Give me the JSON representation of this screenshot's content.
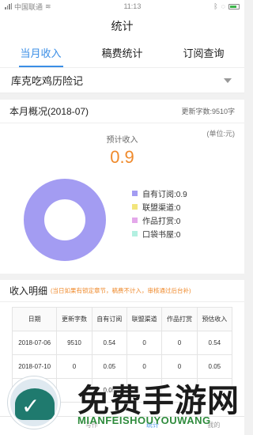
{
  "status_bar": {
    "carrier": "中国联通",
    "time": "11:13"
  },
  "nav": {
    "title": "统计"
  },
  "tabs": [
    {
      "label": "当月收入",
      "active": true
    },
    {
      "label": "稿费统计",
      "active": false
    },
    {
      "label": "订阅查询",
      "active": false
    }
  ],
  "book_select": {
    "value": "库克吃鸡历险记"
  },
  "overview": {
    "title": "本月概况(2018-07)",
    "words": "更新字数:9510字",
    "unit": "(单位:元)",
    "estimate_label": "预计收入",
    "estimate_value": "0.9"
  },
  "chart_data": {
    "type": "pie",
    "categories": [
      "自有订阅",
      "联盟渠道",
      "作品打赏",
      "口袋书屋"
    ],
    "values": [
      0.9,
      0,
      0,
      0
    ],
    "legend_labels": [
      "自有订阅:0.9",
      "联盟渠道:0",
      "作品打赏:0",
      "口袋书屋:0"
    ],
    "colors": [
      "#a39cf2",
      "#f2e57c",
      "#e4a8ea",
      "#b3f0e1"
    ],
    "legend_position": "right"
  },
  "income": {
    "title": "收入明细",
    "note": "(当日如果有锁定章节，稿费不计入，审核通过后台补)",
    "columns": [
      "日期",
      "更新字数",
      "自有订阅",
      "联盟渠道",
      "作品打赏",
      "预估收入"
    ],
    "rows": [
      [
        "2018-07-06",
        "9510",
        "0.54",
        "0",
        "0",
        "0.54"
      ],
      [
        "2018-07-10",
        "0",
        "0.05",
        "0",
        "0",
        "0.05"
      ],
      [
        "",
        "",
        "0.05",
        "",
        "",
        ""
      ]
    ]
  },
  "bottom_nav": [
    "消息",
    "写作",
    "统计",
    "我的"
  ],
  "watermark": {
    "title": "免费手游网",
    "subtitle": "MIANFEISHOUYOUWANG"
  }
}
